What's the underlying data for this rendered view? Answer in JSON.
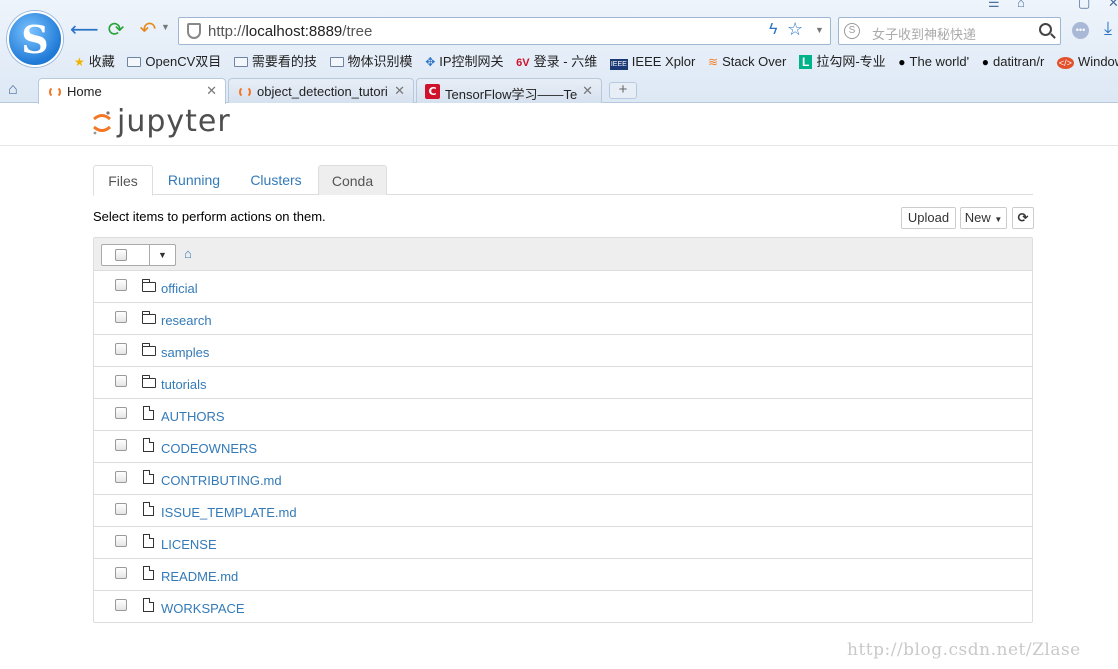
{
  "browser": {
    "logo_letter": "S",
    "url_prefix": "http://",
    "url_host": "localhost:8889",
    "url_path": "/tree",
    "search_placeholder": "女子收到神秘快递",
    "bookmarks": [
      {
        "label": "收藏",
        "icon": "star-icon"
      },
      {
        "label": "OpenCV双目",
        "icon": "folder-icon"
      },
      {
        "label": "需要看的技",
        "icon": "folder-icon"
      },
      {
        "label": "物体识别模",
        "icon": "folder-icon"
      },
      {
        "label": "IP控制网关",
        "icon": "network-icon"
      },
      {
        "label": "登录 - 六维",
        "icon": "sixv-icon"
      },
      {
        "label": "IEEE Xplor",
        "icon": "ieee-icon"
      },
      {
        "label": "Stack Over",
        "icon": "stackoverflow-icon"
      },
      {
        "label": "拉勾网-专业",
        "icon": "lagou-icon"
      },
      {
        "label": "The world'",
        "icon": "github-icon"
      },
      {
        "label": "datitran/r",
        "icon": "github-icon"
      },
      {
        "label": "Windows",
        "icon": "code-icon"
      }
    ],
    "tabs": [
      {
        "title": "Home",
        "active": true
      },
      {
        "title": "object_detection_tutori",
        "active": false
      },
      {
        "title": "TensorFlow学习——Te",
        "active": false
      }
    ]
  },
  "jupyter": {
    "logo_text": "jupyter",
    "tabs": [
      {
        "label": "Files",
        "active": true
      },
      {
        "label": "Running",
        "active": false
      },
      {
        "label": "Clusters",
        "active": false
      },
      {
        "label": "Conda",
        "active": false
      }
    ],
    "hint": "Select items to perform actions on them.",
    "upload_label": "Upload",
    "new_label": "New",
    "items": [
      {
        "name": "official",
        "type": "folder"
      },
      {
        "name": "research",
        "type": "folder"
      },
      {
        "name": "samples",
        "type": "folder"
      },
      {
        "name": "tutorials",
        "type": "folder"
      },
      {
        "name": "AUTHORS",
        "type": "file"
      },
      {
        "name": "CODEOWNERS",
        "type": "file"
      },
      {
        "name": "CONTRIBUTING.md",
        "type": "file"
      },
      {
        "name": "ISSUE_TEMPLATE.md",
        "type": "file"
      },
      {
        "name": "LICENSE",
        "type": "file"
      },
      {
        "name": "README.md",
        "type": "file"
      },
      {
        "name": "WORKSPACE",
        "type": "file"
      }
    ]
  },
  "watermark": "http://blog.csdn.net/Zlase",
  "colors": {
    "link": "#337ab7",
    "jupyter_orange": "#f37726"
  }
}
